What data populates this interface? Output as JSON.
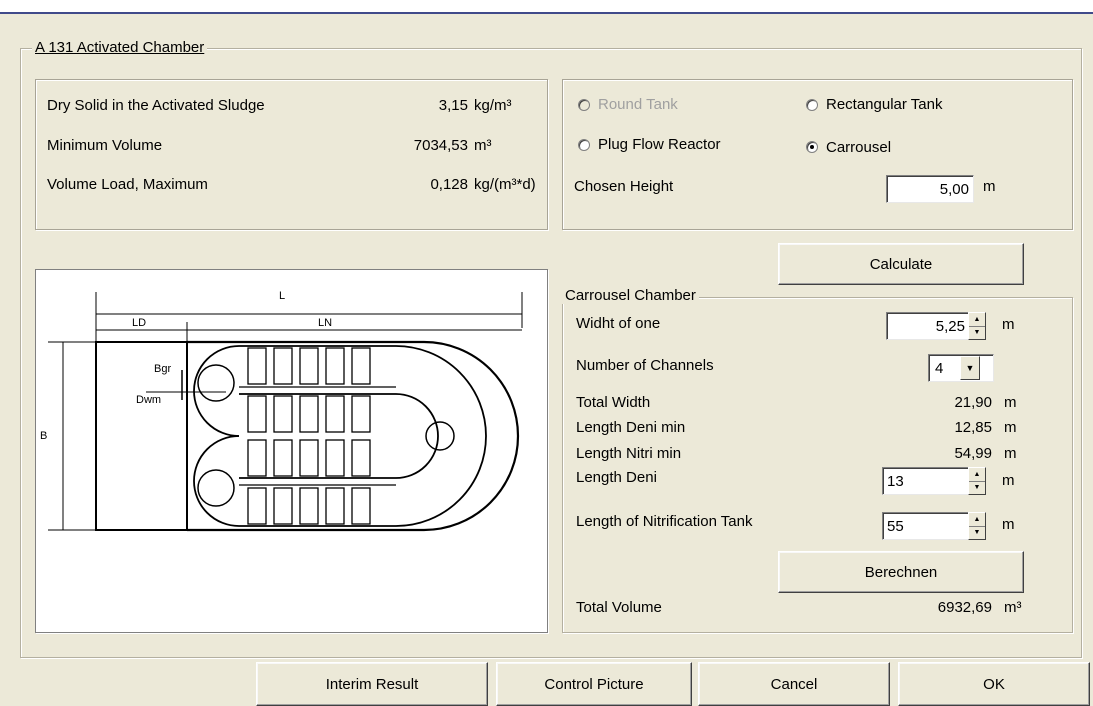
{
  "group_title": "A 131 Activated Chamber",
  "info": {
    "rows": [
      {
        "label": "Dry Solid in the Activated Sludge",
        "value": "3,15",
        "unit": "kg/m³"
      },
      {
        "label": "Minimum Volume",
        "value": "7034,53",
        "unit": "m³"
      },
      {
        "label": "Volume Load, Maximum",
        "value": "0,128",
        "unit": "kg/(m³*d)"
      }
    ]
  },
  "tank_type": {
    "options": [
      {
        "label": "Round Tank",
        "checked": false,
        "disabled": true
      },
      {
        "label": "Rectangular Tank",
        "checked": false,
        "disabled": false
      },
      {
        "label": "Plug Flow Reactor",
        "checked": false,
        "disabled": false
      },
      {
        "label": "Carrousel",
        "checked": true,
        "disabled": false
      }
    ],
    "height_label": "Chosen Height",
    "height_value": "5,00",
    "height_unit": "m"
  },
  "calculate_label": "Calculate",
  "diagram": {
    "L": "L",
    "LD": "LD",
    "LN": "LN",
    "Bgr": "Bgr",
    "Dwm": "Dwm",
    "B": "B"
  },
  "carrousel": {
    "title": "Carrousel Chamber",
    "width_label": "Widht of one",
    "width_value": "5,25",
    "width_unit": "m",
    "channels_label": "Number of Channels",
    "channels_value": "4",
    "total_width_label": "Total Width",
    "total_width_value": "21,90",
    "total_width_unit": "m",
    "deni_min_label": "Length Deni min",
    "deni_min_value": "12,85",
    "deni_min_unit": "m",
    "nitri_min_label": "Length Nitri min",
    "nitri_min_value": "54,99",
    "nitri_min_unit": "m",
    "deni_label": "Length Deni",
    "deni_value": "13",
    "deni_unit": "m",
    "nitri_tank_label": "Length of Nitrification Tank",
    "nitri_tank_value": "55",
    "nitri_tank_unit": "m",
    "berechnen_label": "Berechnen",
    "total_volume_label": "Total Volume",
    "total_volume_value": "6932,69",
    "total_volume_unit": "m³"
  },
  "buttons": {
    "interim": "Interim Result",
    "control": "Control Picture",
    "cancel": "Cancel",
    "ok": "OK"
  }
}
